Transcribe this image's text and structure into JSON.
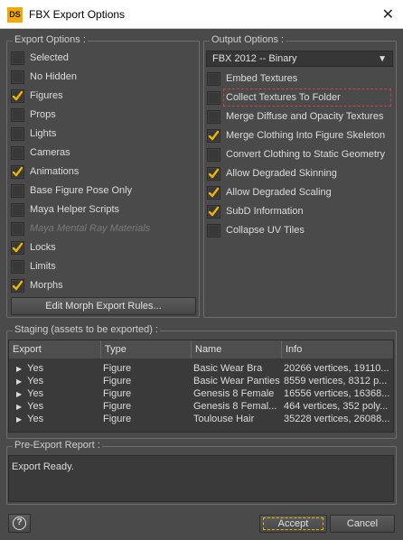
{
  "window": {
    "title": "FBX Export Options",
    "icon_text": "DS",
    "close_glyph": "✕"
  },
  "export_options": {
    "title": "Export Options :",
    "items": [
      {
        "label": "Selected",
        "checked": false,
        "disabled": false
      },
      {
        "label": "No Hidden",
        "checked": false,
        "disabled": false
      },
      {
        "label": "Figures",
        "checked": true,
        "disabled": false
      },
      {
        "label": "Props",
        "checked": false,
        "disabled": false
      },
      {
        "label": "Lights",
        "checked": false,
        "disabled": false
      },
      {
        "label": "Cameras",
        "checked": false,
        "disabled": false
      },
      {
        "label": "Animations",
        "checked": true,
        "disabled": false
      },
      {
        "label": "Base Figure Pose Only",
        "checked": false,
        "disabled": false
      },
      {
        "label": "Maya Helper Scripts",
        "checked": false,
        "disabled": false
      },
      {
        "label": "Maya Mental Ray Materials",
        "checked": false,
        "disabled": true
      },
      {
        "label": "Locks",
        "checked": true,
        "disabled": false
      },
      {
        "label": "Limits",
        "checked": false,
        "disabled": false
      },
      {
        "label": "Morphs",
        "checked": true,
        "disabled": false
      }
    ],
    "edit_morph_button": "Edit Morph Export Rules..."
  },
  "output_options": {
    "title": "Output Options :",
    "format_selected": "FBX 2012 -- Binary",
    "items": [
      {
        "label": "Embed Textures",
        "checked": false
      },
      {
        "label": "Collect Textures To Folder",
        "checked": false
      },
      {
        "label": "Merge Diffuse and Opacity Textures",
        "checked": false
      },
      {
        "label": "Merge Clothing Into Figure Skeleton",
        "checked": true
      },
      {
        "label": "Convert Clothing to Static Geometry",
        "checked": false
      },
      {
        "label": "Allow Degraded Skinning",
        "checked": true
      },
      {
        "label": "Allow Degraded Scaling",
        "checked": true
      },
      {
        "label": "SubD Information",
        "checked": true
      },
      {
        "label": "Collapse UV Tiles",
        "checked": false
      }
    ]
  },
  "staging": {
    "title": "Staging (assets to be exported) :",
    "columns": [
      "Export",
      "Type",
      "Name",
      "Info"
    ],
    "rows": [
      {
        "export": "Yes",
        "type": "Figure",
        "name": "Basic Wear Bra",
        "info": "20266 vertices, 19110..."
      },
      {
        "export": "Yes",
        "type": "Figure",
        "name": "Basic Wear Panties",
        "info": "8559 vertices, 8312 p..."
      },
      {
        "export": "Yes",
        "type": "Figure",
        "name": "Genesis 8 Female",
        "info": "16556 vertices, 16368..."
      },
      {
        "export": "Yes",
        "type": "Figure",
        "name": "Genesis 8 Femal...",
        "info": "464 vertices, 352 poly..."
      },
      {
        "export": "Yes",
        "type": "Figure",
        "name": "Toulouse Hair",
        "info": "35228 vertices, 26088..."
      }
    ]
  },
  "report": {
    "title": "Pre-Export Report :",
    "text": "Export Ready."
  },
  "footer": {
    "help_glyph": "?",
    "accept_label": "Accept",
    "cancel_label": "Cancel"
  },
  "colors": {
    "check": "#f0b400",
    "background": "#4a4a4a",
    "focus_dash_red": "#c24848"
  }
}
